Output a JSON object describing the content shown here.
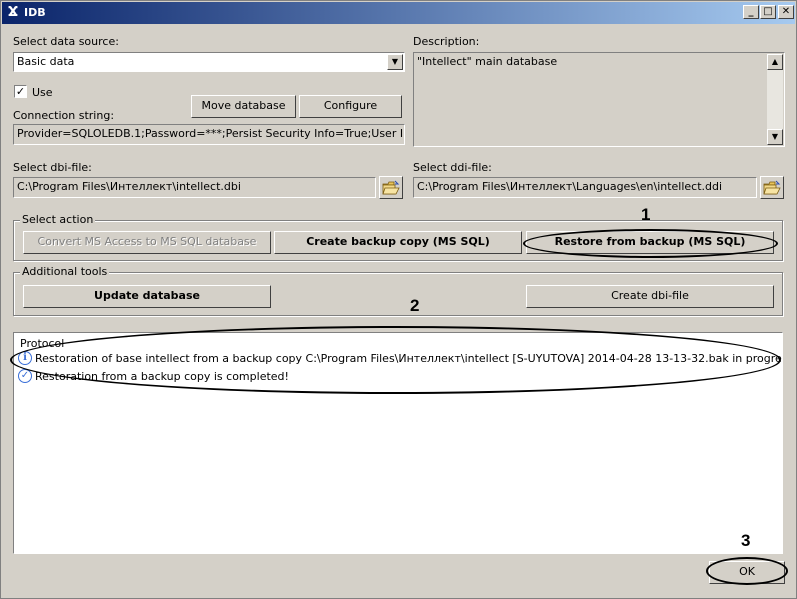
{
  "window": {
    "title": "IDB",
    "logo_glyph": "Ϫ",
    "minimize_glyph": "_",
    "maximize_glyph": "□",
    "close_glyph": "✕"
  },
  "data_source": {
    "label": "Select data source:",
    "value": "Basic data",
    "dropdown_glyph": "▼",
    "use_label": "Use",
    "use_checked": true,
    "check_glyph": "✓",
    "connection_label": "Connection string:",
    "connection_value": "Provider=SQLOLEDB.1;Password=***;Persist Security Info=True;User ID=sa;",
    "move_database_label": "Move database",
    "configure_label": "Configure"
  },
  "description": {
    "label": "Description:",
    "value": "\"Intellect\" main database",
    "scroll_up_glyph": "▲",
    "scroll_down_glyph": "▼"
  },
  "dbi": {
    "label": "Select dbi-file:",
    "value": "C:\\Program Files\\Интеллект\\intellect.dbi"
  },
  "ddi": {
    "label": "Select ddi-file:",
    "value": "C:\\Program Files\\Интеллект\\Languages\\en\\intellect.ddi"
  },
  "select_action": {
    "title": "Select action",
    "convert_label": "Convert MS Access to MS SQL database",
    "backup_label": "Create backup copy (MS SQL)",
    "restore_label": "Restore from backup (MS SQL)"
  },
  "additional_tools": {
    "title": "Additional tools",
    "update_label": "Update database",
    "create_dbi_label": "Create dbi-file"
  },
  "protocol": {
    "title": "Protocol",
    "rows": [
      {
        "icon": "info-icon",
        "text": "Restoration of base intellect from a backup copy C:\\Program Files\\Интеллект\\intellect [S-UYUTOVA] 2014-04-28 13-13-32.bak in progress, wait"
      },
      {
        "icon": "check-icon",
        "text": "Restoration from a backup copy is completed!"
      }
    ]
  },
  "ok_label": "OK",
  "callouts": {
    "one": "1",
    "two": "2",
    "three": "3"
  },
  "colors": {
    "title_gradient_start": "#0a246a",
    "title_gradient_end": "#a6caf0",
    "window_bg": "#d4d0c8",
    "info_icon": "#3a6fd8"
  }
}
